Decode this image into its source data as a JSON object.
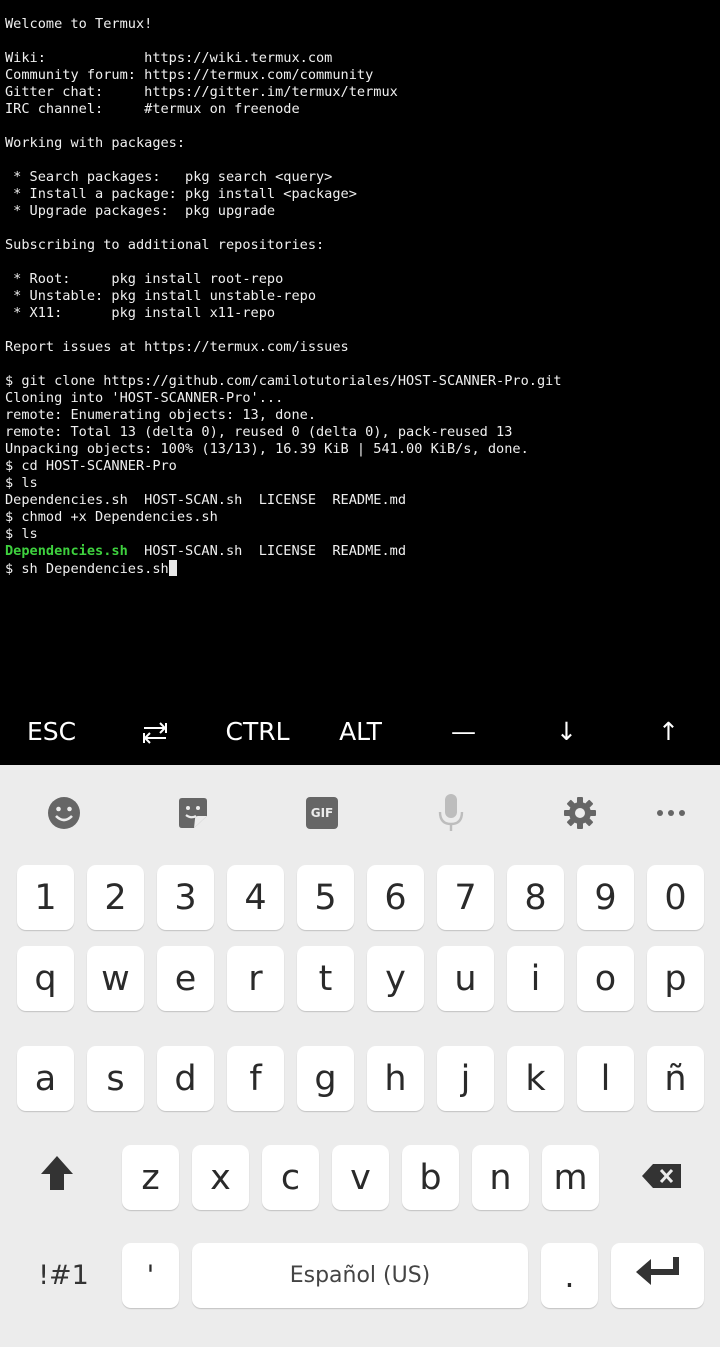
{
  "terminal": {
    "lines": [
      "Welcome to Termux!",
      "",
      "Wiki:            https://wiki.termux.com",
      "Community forum: https://termux.com/community",
      "Gitter chat:     https://gitter.im/termux/termux",
      "IRC channel:     #termux on freenode",
      "",
      "Working with packages:",
      "",
      " * Search packages:   pkg search <query>",
      " * Install a package: pkg install <package>",
      " * Upgrade packages:  pkg upgrade",
      "",
      "Subscribing to additional repositories:",
      "",
      " * Root:     pkg install root-repo",
      " * Unstable: pkg install unstable-repo",
      " * X11:      pkg install x11-repo",
      "",
      "Report issues at https://termux.com/issues",
      "",
      "$ git clone https://github.com/camilotutoriales/HOST-SCANNER-Pro.git",
      "Cloning into 'HOST-SCANNER-Pro'...",
      "remote: Enumerating objects: 13, done.",
      "remote: Total 13 (delta 0), reused 0 (delta 0), pack-reused 13",
      "Unpacking objects: 100% (13/13), 16.39 KiB | 541.00 KiB/s, done.",
      "$ cd HOST-SCANNER-Pro",
      "$ ls",
      "Dependencies.sh  HOST-SCAN.sh  LICENSE  README.md",
      "$ chmod +x Dependencies.sh",
      "$ ls"
    ],
    "ls_highlight": "Dependencies.sh",
    "ls_rest": "  HOST-SCAN.sh  LICENSE  README.md",
    "prompt_line": "$ sh Dependencies.sh",
    "highlight_color": "#3ed13e"
  },
  "extra_keys": {
    "esc": "ESC",
    "tab_icon": "tab-arrows-icon",
    "ctrl": "CTRL",
    "alt": "ALT",
    "dash": "—",
    "down": "↓",
    "up": "↑"
  },
  "keyboard": {
    "toolbar": [
      "emoji-icon",
      "sticker-icon",
      "gif-icon",
      "microphone-icon",
      "settings-gear-icon",
      "more-icon"
    ],
    "gif_label": "GIF",
    "number_row": [
      "1",
      "2",
      "3",
      "4",
      "5",
      "6",
      "7",
      "8",
      "9",
      "0"
    ],
    "row1": [
      "q",
      "w",
      "e",
      "r",
      "t",
      "y",
      "u",
      "i",
      "o",
      "p"
    ],
    "row2": [
      "a",
      "s",
      "d",
      "f",
      "g",
      "h",
      "j",
      "k",
      "l",
      "ñ"
    ],
    "row3": [
      "z",
      "x",
      "c",
      "v",
      "b",
      "n",
      "m"
    ],
    "symbols_label": "!#1",
    "apostrophe": "'",
    "space_label": "Español (US)",
    "period": ".",
    "shift_icon": "shift-arrow-icon",
    "backspace_icon": "backspace-icon",
    "enter_icon": "enter-arrow-icon"
  }
}
